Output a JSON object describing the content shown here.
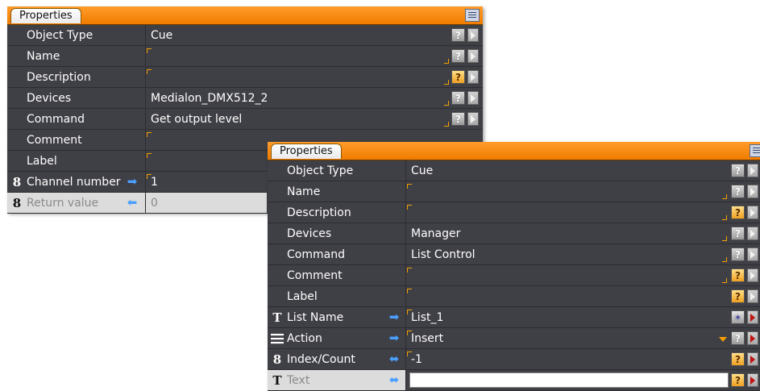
{
  "panel1": {
    "tab_label": "Properties",
    "rows": [
      {
        "label": "Object Type",
        "value": "Cue"
      },
      {
        "label": "Name",
        "value": ""
      },
      {
        "label": "Description",
        "value": ""
      },
      {
        "label": "Devices",
        "value": "Medialon_DMX512_2"
      },
      {
        "label": "Command",
        "value": "Get output level"
      },
      {
        "label": "Comment",
        "value": ""
      },
      {
        "label": "Label",
        "value": ""
      },
      {
        "label": "Channel number",
        "value": "1",
        "icon": "numeric-8-icon"
      },
      {
        "label": "Return value",
        "value": "0",
        "icon": "numeric-8-icon"
      }
    ]
  },
  "panel2": {
    "tab_label": "Properties",
    "rows": [
      {
        "label": "Object Type",
        "value": "Cue"
      },
      {
        "label": "Name",
        "value": ""
      },
      {
        "label": "Description",
        "value": ""
      },
      {
        "label": "Devices",
        "value": "Manager"
      },
      {
        "label": "Command",
        "value": "List Control"
      },
      {
        "label": "Comment",
        "value": ""
      },
      {
        "label": "Label",
        "value": ""
      },
      {
        "label": "List Name",
        "value": "List_1",
        "icon": "text-type-icon"
      },
      {
        "label": "Action",
        "value": "Insert",
        "icon": "list-type-icon"
      },
      {
        "label": "Index/Count",
        "value": "-1",
        "icon": "numeric-8-icon"
      },
      {
        "label": "Text",
        "value": "",
        "icon": "text-type-icon"
      }
    ]
  },
  "glyphs": {
    "help": "?",
    "numeric": "8",
    "text": "T",
    "arrow_in": "➡",
    "arrow_out": "⬅",
    "arrow_both": "⬌",
    "wand": "✶"
  },
  "colors": {
    "header_orange": "#f07c00",
    "panel_bg": "#3f3f46",
    "accent_corner": "#f5a000",
    "arrow_blue": "#4aa0ff"
  }
}
